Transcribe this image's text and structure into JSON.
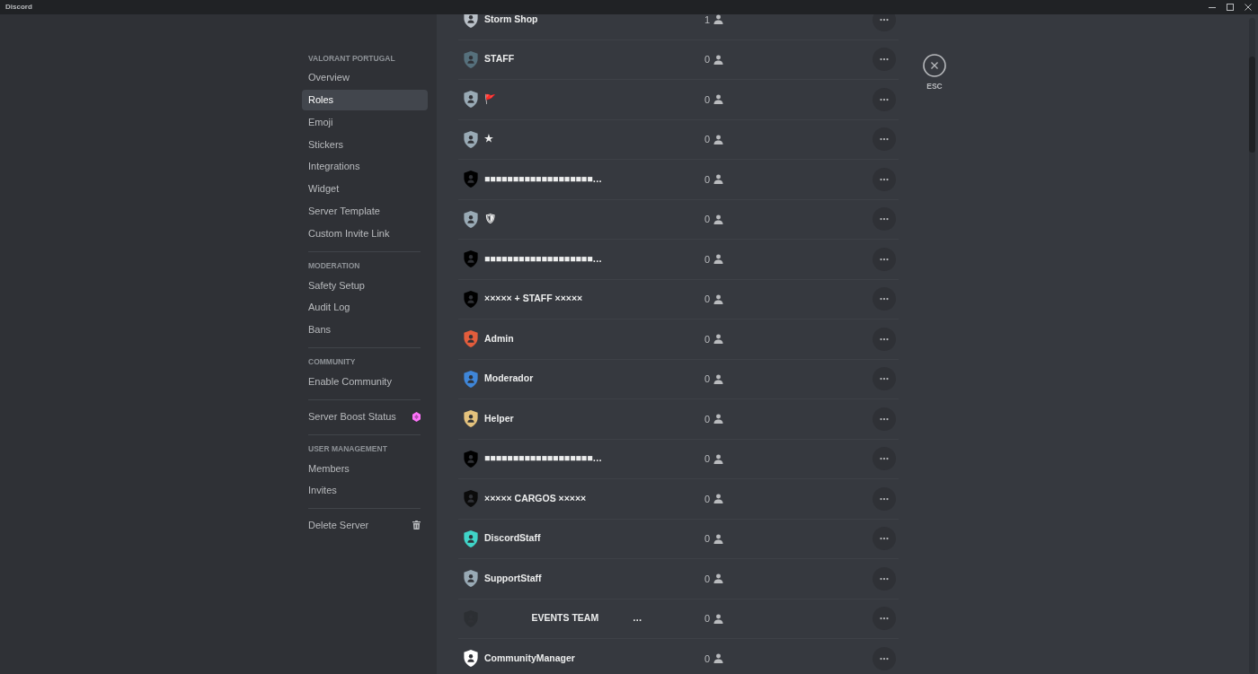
{
  "window": {
    "title": "Discord"
  },
  "sidebar": {
    "sections": [
      {
        "header": "VALORANT PORTUGAL",
        "items": [
          {
            "label": "Overview",
            "kind": "link",
            "selected": false
          },
          {
            "label": "Roles",
            "kind": "link",
            "selected": true
          },
          {
            "label": "Emoji",
            "kind": "link",
            "selected": false
          },
          {
            "label": "Stickers",
            "kind": "link",
            "selected": false
          },
          {
            "label": "Integrations",
            "kind": "link",
            "selected": false
          },
          {
            "label": "Widget",
            "kind": "link",
            "selected": false
          },
          {
            "label": "Server Template",
            "kind": "link",
            "selected": false
          },
          {
            "label": "Custom Invite Link",
            "kind": "link",
            "selected": false
          }
        ]
      },
      {
        "header": "MODERATION",
        "items": [
          {
            "label": "Safety Setup",
            "kind": "link",
            "selected": false
          },
          {
            "label": "Audit Log",
            "kind": "link",
            "selected": false
          },
          {
            "label": "Bans",
            "kind": "link",
            "selected": false
          }
        ]
      },
      {
        "header": "COMMUNITY",
        "items": [
          {
            "label": "Enable Community",
            "kind": "link",
            "selected": false
          }
        ]
      },
      {
        "items": [
          {
            "label": "Server Boost Status",
            "kind": "boost",
            "selected": false
          }
        ]
      },
      {
        "header": "USER MANAGEMENT",
        "items": [
          {
            "label": "Members",
            "kind": "link",
            "selected": false
          },
          {
            "label": "Invites",
            "kind": "link",
            "selected": false
          }
        ]
      },
      {
        "items": [
          {
            "label": "Delete Server",
            "kind": "delete",
            "selected": false
          }
        ]
      }
    ]
  },
  "roles": [
    {
      "name": "Storm Shop",
      "color": "#b9c0c7",
      "members": "1"
    },
    {
      "name": "STAFF",
      "color": "#56707c",
      "members": "0"
    },
    {
      "name": "🚩",
      "color": "#99aab5",
      "members": "0"
    },
    {
      "name": "★",
      "color": "#99aab5",
      "members": "0"
    },
    {
      "name": "■■■■■■■■■■■■■■■■■■■…",
      "color": "#000000",
      "members": "0"
    },
    {
      "name": "🛡",
      "color": "#99aab5",
      "members": "0"
    },
    {
      "name": "■■■■■■■■■■■■■■■■■■■…",
      "color": "#000000",
      "members": "0"
    },
    {
      "name": "××××× + STAFF ×××××",
      "color": "#000000",
      "members": "0"
    },
    {
      "name": "Admin",
      "color": "#e35d3c",
      "members": "0"
    },
    {
      "name": "Moderador",
      "color": "#3f86d8",
      "members": "0"
    },
    {
      "name": "Helper",
      "color": "#e4c27d",
      "members": "0"
    },
    {
      "name": "■■■■■■■■■■■■■■■■■■■…",
      "color": "#000000",
      "members": "0"
    },
    {
      "name": "××××× CARGOS ×××××",
      "color": "#0b0b0b",
      "members": "0"
    },
    {
      "name": "DiscordStaff",
      "color": "#40d4c8",
      "members": "0"
    },
    {
      "name": "SupportStaff",
      "color": "#99aab5",
      "members": "0"
    },
    {
      "name": "                  EVENTS TEAM             …",
      "color": "#2c2f33",
      "members": "0"
    },
    {
      "name": "CommunityManager",
      "color": "#ffffff",
      "members": "0"
    }
  ],
  "close": {
    "label": "ESC"
  }
}
